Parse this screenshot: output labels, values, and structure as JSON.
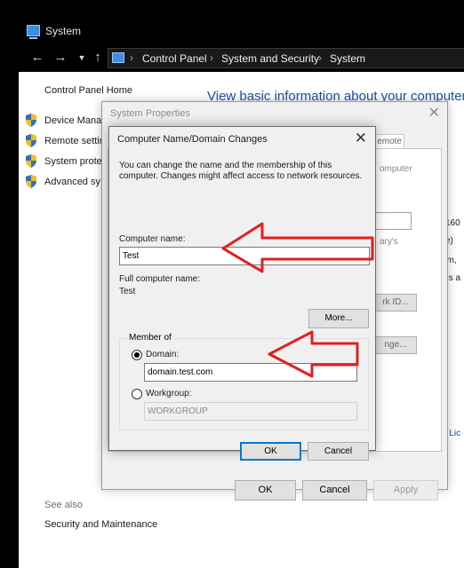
{
  "window": {
    "title": "System"
  },
  "address_bar": {
    "crumbs": [
      "Control Panel",
      "System and Security",
      "System"
    ]
  },
  "control_panel": {
    "home_link": "Control Panel Home",
    "heading": "View basic information about your computer",
    "side_links": [
      "Device Mana",
      "Remote settin",
      "System prote",
      "Advanced sy"
    ],
    "see_also": "See also",
    "security_maintenance": "Security and Maintenance",
    "fragments": {
      "f160": "160",
      "fe": "e)",
      "fem": "em,",
      "fta": "t is a",
      "flic": "e Lic"
    }
  },
  "system_properties": {
    "title": "System Properties",
    "tab_remote": "emote",
    "text_computer": "omputer",
    "text_arys": "ary's",
    "btn_network_id": "rk ID...",
    "btn_change": "nge...",
    "ok": "OK",
    "cancel": "Cancel",
    "apply": "Apply"
  },
  "name_domain_dialog": {
    "title": "Computer Name/Domain Changes",
    "description": "You can change the name and the membership of this computer. Changes might affect access to network resources.",
    "computer_name_label": "Computer name:",
    "computer_name_value": "Test",
    "full_name_label": "Full computer name:",
    "full_name_value": "Test",
    "more_button": "More...",
    "member_of_label": "Member of",
    "domain_label": "Domain:",
    "domain_value": "domain.test.com",
    "domain_selected": true,
    "workgroup_label": "Workgroup:",
    "workgroup_value": "WORKGROUP",
    "ok": "OK",
    "cancel": "Cancel"
  },
  "annotation_color": "#e41e1e"
}
